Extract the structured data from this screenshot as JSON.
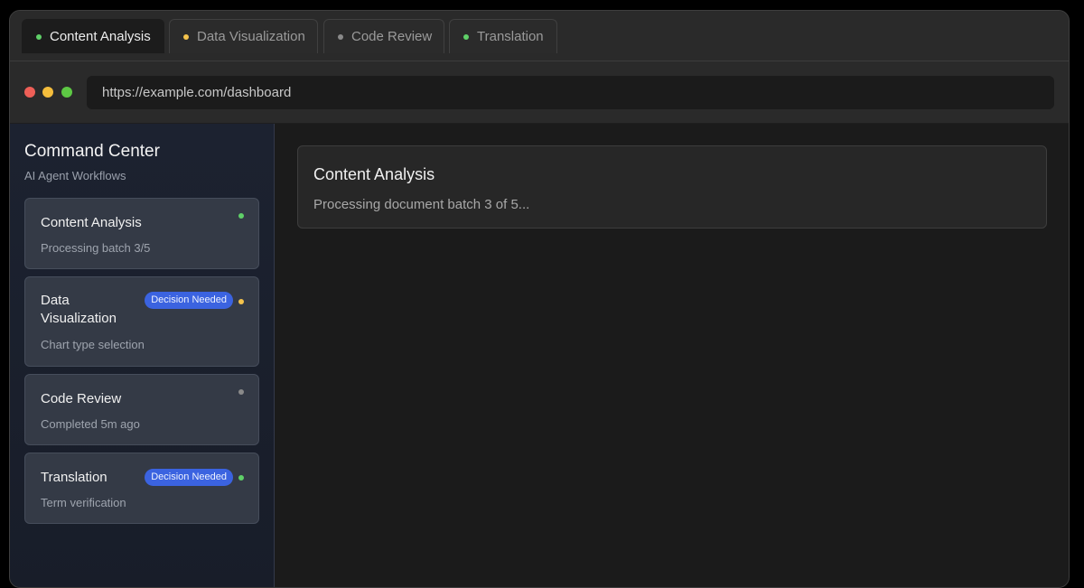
{
  "colors": {
    "green": "#5fd068",
    "yellow": "#f4c34c",
    "gray": "#8a8a8a",
    "red": "#ee5f57",
    "badge": "#3b63e0"
  },
  "tabs": [
    {
      "label": "Content Analysis",
      "status": "green",
      "active": true
    },
    {
      "label": "Data Visualization",
      "status": "yellow",
      "active": false
    },
    {
      "label": "Code Review",
      "status": "gray",
      "active": false
    },
    {
      "label": "Translation",
      "status": "green",
      "active": false
    }
  ],
  "address_bar": {
    "url": "https://example.com/dashboard"
  },
  "sidebar": {
    "title": "Command Center",
    "subtitle": "AI Agent Workflows",
    "cards": [
      {
        "title": "Content Analysis",
        "subtitle": "Processing batch 3/5",
        "status": "green",
        "badge": ""
      },
      {
        "title": "Data Visualization",
        "subtitle": "Chart type selection",
        "status": "yellow",
        "badge": "Decision Needed"
      },
      {
        "title": "Code Review",
        "subtitle": "Completed 5m ago",
        "status": "gray",
        "badge": ""
      },
      {
        "title": "Translation",
        "subtitle": "Term verification",
        "status": "green",
        "badge": "Decision Needed"
      }
    ]
  },
  "main": {
    "panel_title": "Content Analysis",
    "panel_text": "Processing document batch 3 of 5..."
  }
}
